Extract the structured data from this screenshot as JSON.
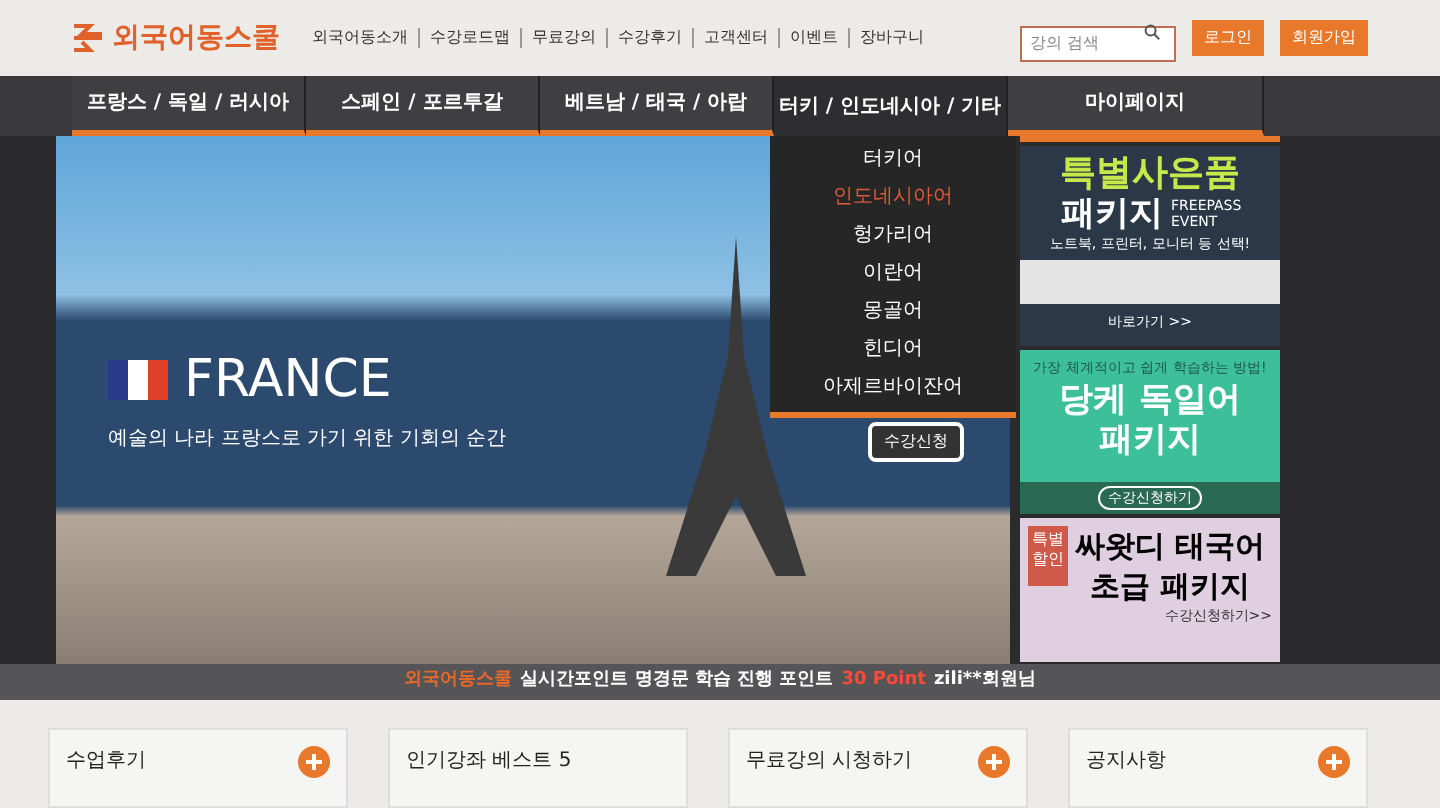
{
  "header": {
    "logo": "외국어동스쿨",
    "links": [
      "외국어동소개",
      "수강로드맵",
      "무료강의",
      "수강후기",
      "고객센터",
      "이벤트",
      "장바구니"
    ],
    "search": {
      "placeholder": "강의 검색"
    },
    "buttons": [
      "로그인",
      "회원가입"
    ]
  },
  "nav": {
    "tabs": [
      {
        "label": "프랑스 / 독일 / 러시아",
        "selected": true
      },
      {
        "label": "스페인 / 포르투갈",
        "selected": true
      },
      {
        "label": "베트남 / 태국 / 아랍",
        "selected": true
      },
      {
        "label": "터키 / 인도네시아 / 기타",
        "selected": false
      },
      {
        "label": "마이페이지",
        "selected": true
      }
    ]
  },
  "dropdown": {
    "items": [
      {
        "label": "터키어",
        "selected": false
      },
      {
        "label": "인도네시아어",
        "selected": true
      },
      {
        "label": "헝가리어",
        "selected": false
      },
      {
        "label": "이란어",
        "selected": false
      },
      {
        "label": "몽골어",
        "selected": false
      },
      {
        "label": "힌디어",
        "selected": false
      },
      {
        "label": "아제르바이잔어",
        "selected": false
      }
    ]
  },
  "hero": {
    "title": "FRANCE",
    "subtitle": "예술의 나라 프랑스로 가기 위한 기회의 순간",
    "button": "수강신청"
  },
  "ads": [
    {
      "kind": "gift",
      "title": "특별사은품",
      "title2": "패키지",
      "event": "FREEPASS EVENT",
      "desc": "노트북, 프린터, 모니터 등 선택!",
      "link": "바로가기 >>"
    },
    {
      "kind": "german",
      "caption": "가장 체계적이고 쉽게 학습하는 방법!",
      "title": "당케 독일어",
      "title2": "패키지",
      "link": "수강신청하기"
    },
    {
      "kind": "thai",
      "badge": "특별 할인",
      "title": "싸왓디 태국어",
      "title2": "초급 패키지",
      "link": "수강신청하기>>"
    }
  ],
  "ticker": {
    "brand": "외국어동스쿨",
    "text": "실시간포인트 명경문 학습 진행 포인트",
    "points": "30 Point",
    "user": "zili**회원님"
  },
  "cards": [
    "수업후기",
    "인기강좌 베스트 5",
    "무료강의 시청하기",
    "공지사항"
  ]
}
